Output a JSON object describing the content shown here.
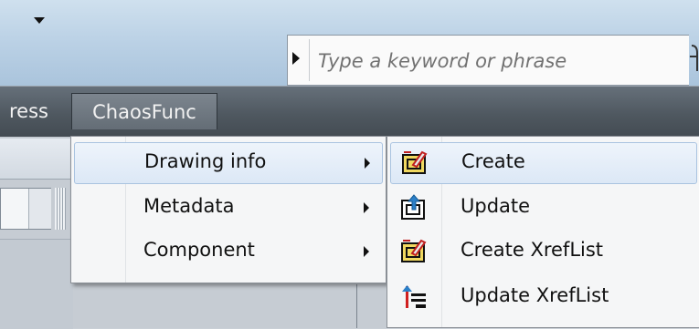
{
  "search": {
    "placeholder": "Type a keyword or phrase"
  },
  "menubar": {
    "items": [
      {
        "label": "ress",
        "state": "partial"
      },
      {
        "label": "ChaosFunc",
        "state": "open"
      }
    ]
  },
  "menu": {
    "items": [
      {
        "label": "Drawing info",
        "has_submenu": true,
        "highlighted": true
      },
      {
        "label": "Metadata",
        "has_submenu": true,
        "highlighted": false
      },
      {
        "label": "Component",
        "has_submenu": true,
        "highlighted": false
      }
    ]
  },
  "submenu": {
    "parent": "Drawing info",
    "items": [
      {
        "label": "Create",
        "icon": "drawing-create-icon",
        "highlighted": true
      },
      {
        "label": "Update",
        "icon": "drawing-update-icon",
        "highlighted": false
      },
      {
        "label": "Create XrefList",
        "icon": "xreflist-create-icon",
        "highlighted": false
      },
      {
        "label": "Update XrefList",
        "icon": "xreflist-update-icon",
        "highlighted": false
      }
    ]
  },
  "colors": {
    "menubar_bg": "#4f5860",
    "highlight_border": "#a9c3e0",
    "highlight_fill": "#dce8f6",
    "icon_red": "#d02020",
    "icon_blue": "#2a7fc8",
    "icon_yellow": "#f0d860"
  }
}
